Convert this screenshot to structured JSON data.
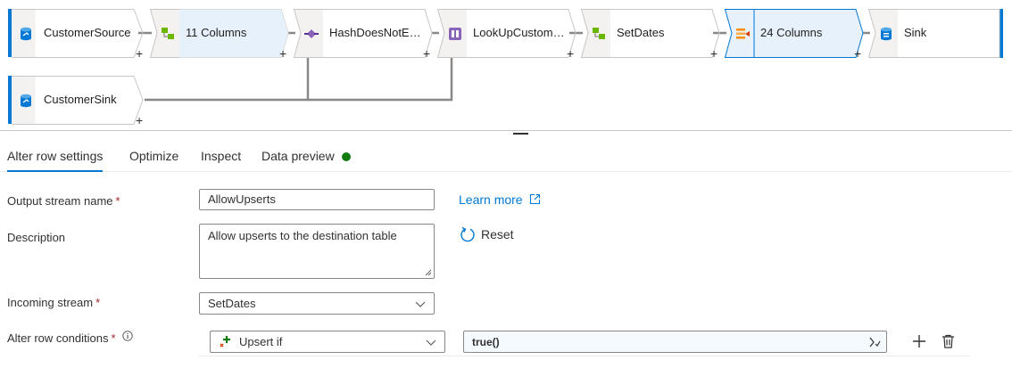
{
  "pipeline": {
    "nodes": [
      {
        "id": "customer-source",
        "label": "CustomerSource",
        "icon": "source-db-icon"
      },
      {
        "id": "select-columns",
        "label": "11 Columns",
        "icon": "select-icon"
      },
      {
        "id": "hash-does-not-exist",
        "label": "HashDoesNotE…",
        "icon": "exists-icon"
      },
      {
        "id": "lookup-customer",
        "label": "LookUpCustom…",
        "icon": "lookup-icon"
      },
      {
        "id": "set-dates",
        "label": "SetDates",
        "icon": "derived-column-icon"
      },
      {
        "id": "alter-row",
        "label": "24 Columns",
        "icon": "alter-row-icon"
      },
      {
        "id": "sink",
        "label": "Sink",
        "icon": "sink-db-icon"
      }
    ],
    "branch_node": {
      "id": "customer-sink",
      "label": "CustomerSink",
      "icon": "source-db-icon"
    },
    "add_symbol": "+"
  },
  "tabs": [
    {
      "label": "Alter row settings",
      "active": true
    },
    {
      "label": "Optimize",
      "active": false
    },
    {
      "label": "Inspect",
      "active": false
    },
    {
      "label": "Data preview",
      "active": false
    }
  ],
  "status_color": "#107c10",
  "form": {
    "output_stream": {
      "label": "Output stream name",
      "value": "AllowUpserts",
      "required": "*"
    },
    "learn_more": "Learn more",
    "description": {
      "label": "Description",
      "value": "Allow upserts to the destination table"
    },
    "reset": "Reset",
    "incoming_stream": {
      "label": "Incoming stream",
      "value": "SetDates",
      "required": "*"
    },
    "alter_conditions": {
      "label": "Alter row conditions",
      "required": "*",
      "condition_type": "Upsert if",
      "expression": "true()"
    }
  },
  "colors": {
    "accent": "#0078d4",
    "selected_fill": "#e7f1fb",
    "node_border": "#c8c6c4",
    "wire": "#8a8886"
  }
}
